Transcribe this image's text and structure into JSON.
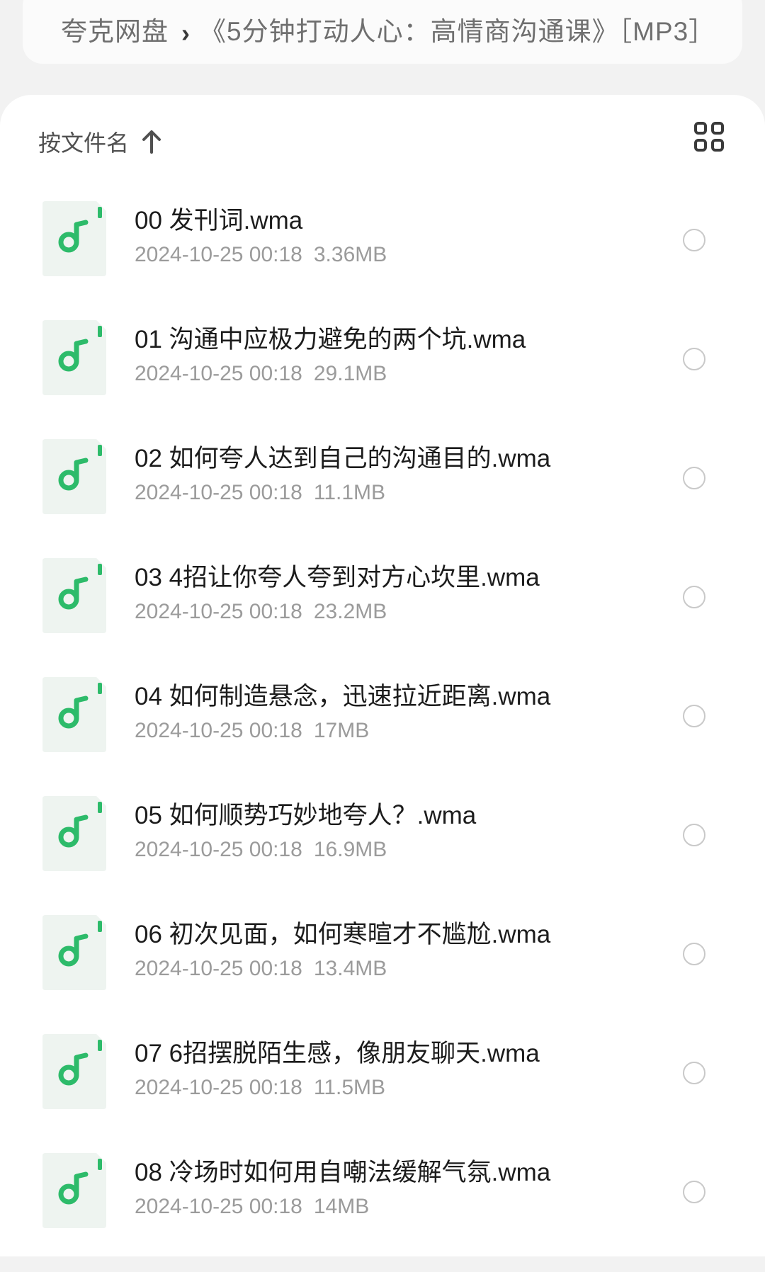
{
  "breadcrumb": {
    "root": "夸克网盘",
    "separator_icon": "chevron-right-icon",
    "folder": "《5分钟打动人心：高情商沟通课》［MP3］"
  },
  "toolbar": {
    "sort_label": "按文件名",
    "sort_direction_icon": "arrow-up-icon",
    "view_toggle_icon": "grid-view-icon"
  },
  "colors": {
    "accent_green": "#2dbb6a",
    "icon_bg": "#eef4f0"
  },
  "files": [
    {
      "name": "00 发刊词.wma",
      "date": "2024-10-25 00:18",
      "size": "3.36MB"
    },
    {
      "name": "01 沟通中应极力避免的两个坑.wma",
      "date": "2024-10-25 00:18",
      "size": "29.1MB"
    },
    {
      "name": "02 如何夸人达到自己的沟通目的.wma",
      "date": "2024-10-25 00:18",
      "size": "11.1MB"
    },
    {
      "name": "03 4招让你夸人夸到对方心坎里.wma",
      "date": "2024-10-25 00:18",
      "size": "23.2MB"
    },
    {
      "name": "04 如何制造悬念，迅速拉近距离.wma",
      "date": "2024-10-25 00:18",
      "size": "17MB"
    },
    {
      "name": "05 如何顺势巧妙地夸人？.wma",
      "date": "2024-10-25 00:18",
      "size": "16.9MB"
    },
    {
      "name": "06 初次见面，如何寒暄才不尴尬.wma",
      "date": "2024-10-25 00:18",
      "size": "13.4MB"
    },
    {
      "name": "07 6招摆脱陌生感，像朋友聊天.wma",
      "date": "2024-10-25 00:18",
      "size": "11.5MB"
    },
    {
      "name": "08 冷场时如何用自嘲法缓解气氛.wma",
      "date": "2024-10-25 00:18",
      "size": "14MB"
    }
  ]
}
